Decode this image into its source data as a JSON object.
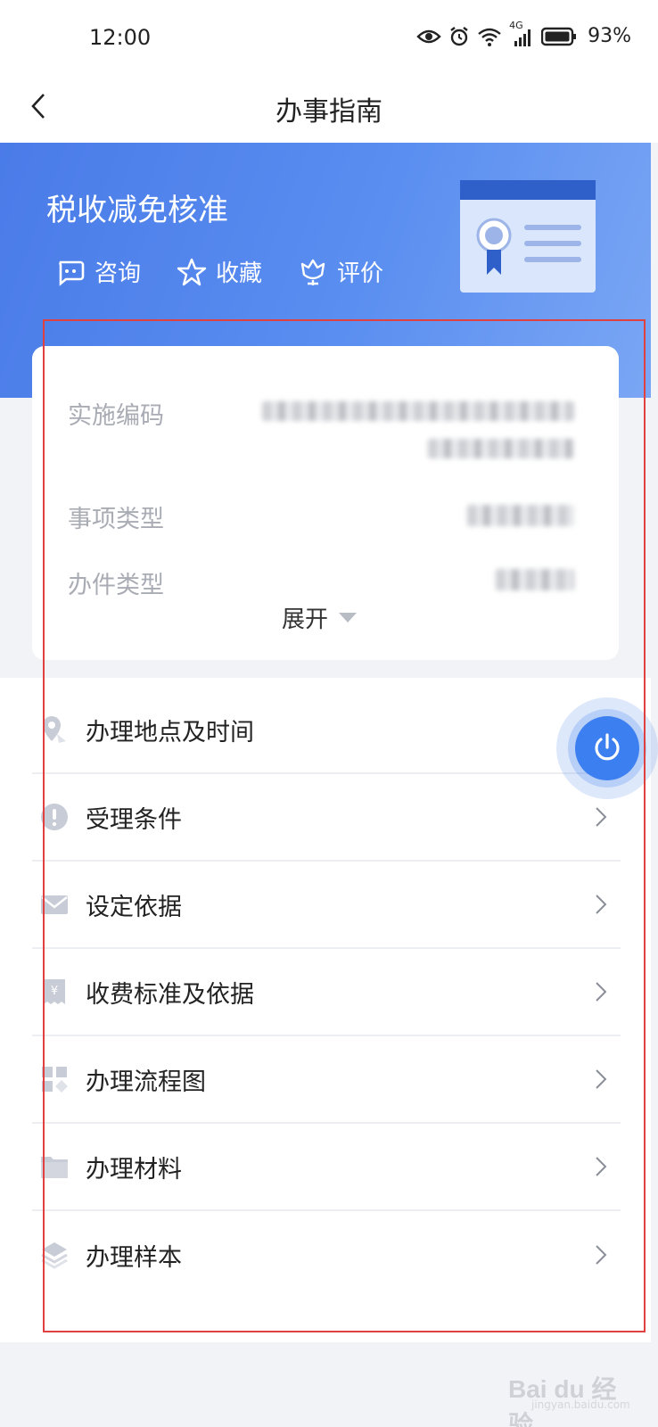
{
  "status_bar": {
    "time": "12:00",
    "network": "4G",
    "battery": "93%"
  },
  "nav": {
    "title": "办事指南"
  },
  "hero": {
    "title": "税收减免核准",
    "actions": [
      {
        "label": "咨询",
        "icon": "chat-icon"
      },
      {
        "label": "收藏",
        "icon": "star-icon"
      },
      {
        "label": "评价",
        "icon": "flower-icon"
      }
    ]
  },
  "info": {
    "rows": [
      {
        "label": "实施编码"
      },
      {
        "label": "事项类型"
      },
      {
        "label": "办件类型"
      }
    ],
    "expand_label": "展开"
  },
  "list": {
    "items": [
      {
        "label": "办理地点及时间",
        "icon": "location-icon"
      },
      {
        "label": "受理条件",
        "icon": "alert-icon"
      },
      {
        "label": "设定依据",
        "icon": "envelope-icon"
      },
      {
        "label": "收费标准及依据",
        "icon": "receipt-icon"
      },
      {
        "label": "办理流程图",
        "icon": "flow-icon"
      },
      {
        "label": "办理材料",
        "icon": "folder-icon"
      },
      {
        "label": "办理样本",
        "icon": "layers-icon"
      }
    ]
  },
  "watermark": {
    "text": "Bai du 经验",
    "sub": "jingyan.baidu.com"
  },
  "colors": {
    "accent": "#3c7ff0",
    "hero_start": "#4a7be8",
    "annotation_red": "#e0403f"
  }
}
